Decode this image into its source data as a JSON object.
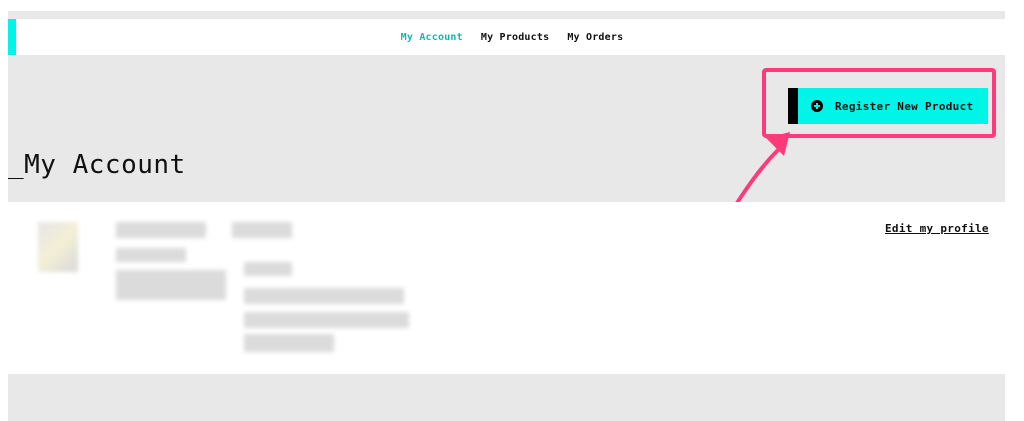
{
  "nav": {
    "items": [
      {
        "label": "My Account",
        "active": true
      },
      {
        "label": "My Products",
        "active": false
      },
      {
        "label": "My Orders",
        "active": false
      }
    ]
  },
  "actions": {
    "register_label": "Register New Product",
    "register_icon": "plus-circle-icon"
  },
  "page": {
    "title": "_My Account"
  },
  "profile": {
    "edit_label": "Edit my profile"
  },
  "colors": {
    "accent": "#00f5e9",
    "active_nav": "#18b5b0",
    "annotation": "#ff3a7a",
    "background": "#e8e8e8"
  }
}
